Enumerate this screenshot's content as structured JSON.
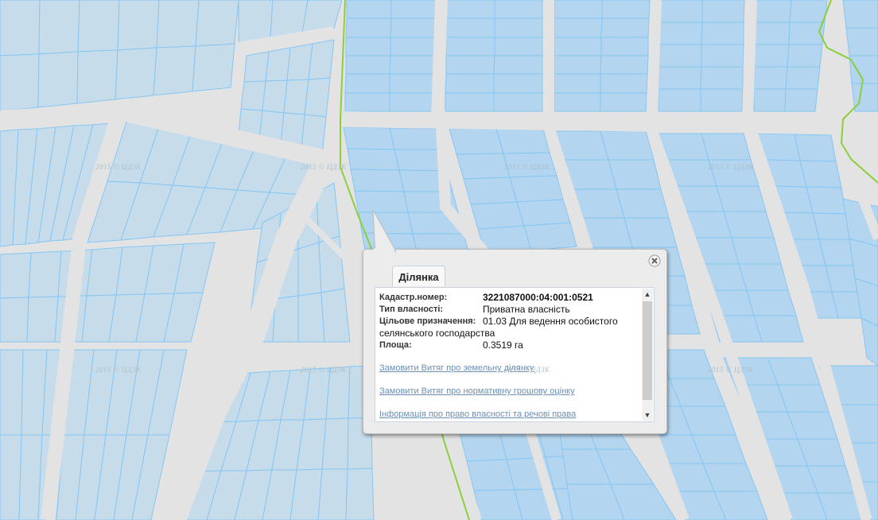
{
  "watermark": "2015 © ЦДЗК",
  "popup": {
    "tab_label": "Ділянка",
    "fields": [
      {
        "label": "Кадастр.номер:",
        "value": "3221087000:04:001:0521"
      },
      {
        "label": "Тип власності:",
        "value": "Приватна власність"
      },
      {
        "label": "Цільове призначення:",
        "value": "01.03 Для ведення особистого"
      },
      {
        "label": "",
        "value": "селянського господарства"
      },
      {
        "label": "Площа:",
        "value": "0.3519 га"
      }
    ],
    "links": [
      "Замовити Витяг про земельну ділянку",
      "Замовити Витяг про нормативну грошову оцінку",
      "Інформація про право власності та речові права"
    ],
    "close_icon": "close-icon"
  },
  "colors": {
    "parcel_fill": "#c6dceb",
    "parcel_selected": "#b3d5ef",
    "parcel_stroke": "#86c6f2",
    "road": "#e3e3e3",
    "boundary": "#8ccf3c"
  }
}
